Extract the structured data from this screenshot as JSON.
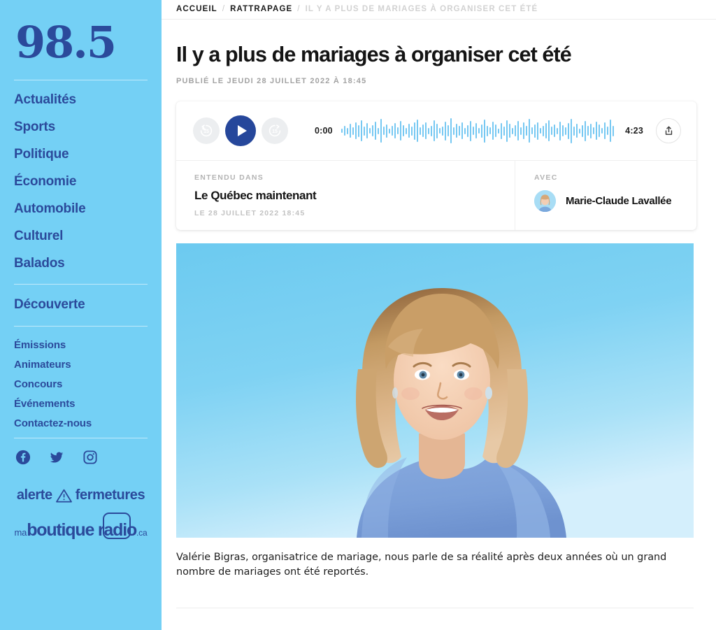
{
  "sidebar": {
    "logo": "98.5",
    "nav_primary": [
      {
        "label": "Actualités"
      },
      {
        "label": "Sports"
      },
      {
        "label": "Politique"
      },
      {
        "label": "Économie"
      },
      {
        "label": "Automobile"
      },
      {
        "label": "Culturel"
      },
      {
        "label": "Balados"
      }
    ],
    "discover_label": "Découverte",
    "nav_secondary": [
      {
        "label": "Émissions"
      },
      {
        "label": "Animateurs"
      },
      {
        "label": "Concours"
      },
      {
        "label": "Événements"
      },
      {
        "label": "Contactez-nous"
      }
    ],
    "social": [
      {
        "name": "facebook-icon"
      },
      {
        "name": "twitter-icon"
      },
      {
        "name": "instagram-icon"
      }
    ],
    "badge_alerte": {
      "word_left": "alerte",
      "word_right": "fermetures"
    },
    "badge_boutique": {
      "prefix": "ma",
      "main": "boutique radio",
      "suffix": ".ca"
    },
    "accent_color": "#2b4a9b",
    "background_color": "#74d0f5"
  },
  "breadcrumb": {
    "home": "ACCUEIL",
    "section": "RATTRAPAGE",
    "current": "IL Y A PLUS DE MARIAGES À ORGANISER CET ÉTÉ",
    "separator": "/"
  },
  "article": {
    "title": "Il y a plus de mariages à organiser cet été",
    "published": "PUBLIÉ LE JEUDI 28 JUILLET 2022 À 18:45",
    "caption": "Valérie Bigras, organisatrice de mariage, nous parle de sa réalité après deux années où un grand nombre de mariages ont été reportés."
  },
  "player": {
    "rewind_label": "15",
    "forward_label": "15",
    "play_icon": "play-icon",
    "current_time": "0:00",
    "duration": "4:23",
    "share_icon": "share-icon",
    "play_color": "#26479b",
    "waveform_color": "#76c8f2",
    "waveform": [
      6,
      14,
      9,
      20,
      11,
      24,
      17,
      30,
      13,
      22,
      8,
      16,
      26,
      9,
      34,
      12,
      19,
      7,
      14,
      22,
      10,
      28,
      16,
      9,
      20,
      13,
      25,
      32,
      11,
      18,
      24,
      9,
      15,
      30,
      21,
      8,
      13,
      27,
      16,
      36,
      11,
      20,
      14,
      24,
      9,
      17,
      29,
      12,
      22,
      8,
      19,
      33,
      15,
      10,
      26,
      18,
      7,
      23,
      13,
      31,
      20,
      9,
      16,
      28,
      11,
      24,
      14,
      34,
      10,
      19,
      25,
      8,
      15,
      22,
      30,
      12,
      18,
      9,
      27,
      16,
      11,
      23,
      35,
      13,
      20,
      7,
      17,
      29,
      14,
      21,
      10,
      26,
      18,
      8,
      24,
      12,
      32,
      15,
      9,
      19,
      27,
      11,
      16,
      23,
      13,
      30,
      20,
      8,
      14,
      25,
      17,
      10,
      22,
      28,
      12,
      19,
      9,
      33,
      15,
      21,
      11,
      24,
      16,
      7,
      26,
      13,
      29,
      18,
      10,
      20,
      14,
      23,
      31,
      9,
      17,
      12,
      25,
      15,
      8,
      19,
      27,
      11,
      22,
      16,
      34,
      13,
      9,
      20,
      24,
      10,
      18,
      28,
      14,
      21,
      7,
      16,
      26,
      12,
      30,
      19,
      11,
      23,
      15,
      9,
      25,
      17,
      13,
      20,
      8,
      22,
      29,
      14,
      18,
      10,
      24,
      16,
      12,
      27,
      21,
      9,
      15,
      32,
      19,
      11,
      17,
      23,
      13,
      26,
      10,
      20,
      14,
      28,
      8,
      18,
      22,
      12,
      16,
      30,
      9,
      21,
      13,
      25,
      11,
      19,
      15,
      24,
      10,
      17,
      27,
      14,
      8,
      20,
      23,
      12,
      16,
      9,
      22,
      18,
      31,
      13,
      10,
      19,
      25,
      11,
      15,
      21,
      17,
      9,
      26,
      12,
      20,
      14,
      23,
      8,
      18,
      16,
      28,
      10,
      13,
      22,
      19,
      11,
      24,
      15,
      9,
      17,
      30,
      12,
      20,
      14,
      8,
      26,
      16,
      10,
      18,
      22,
      13,
      9,
      19,
      15,
      11,
      21,
      17,
      7,
      14,
      24,
      10,
      16,
      12,
      19,
      8,
      22,
      13,
      9,
      17,
      11,
      15,
      20,
      7,
      12,
      9,
      14,
      10,
      6
    ],
    "entendu_dans": {
      "kicker": "ENTENDU DANS",
      "show": "Le Québec maintenant",
      "date": "LE 28 JUILLET 2022 18:45"
    },
    "avec": {
      "kicker": "AVEC",
      "host": "Marie-Claude Lavallée",
      "avatar_icon": "avatar"
    }
  }
}
